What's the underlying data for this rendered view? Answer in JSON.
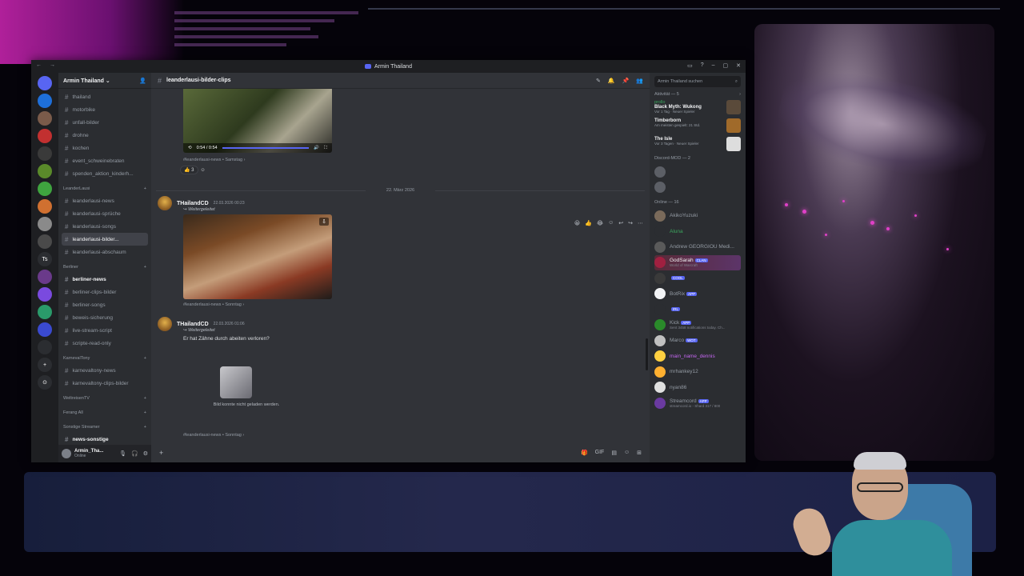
{
  "window": {
    "title": "Armin Thailand",
    "nav_back": "←",
    "nav_forward": "→",
    "controls": [
      "▭",
      "?",
      "–",
      "▢",
      "✕"
    ]
  },
  "servers": [
    "",
    "",
    "",
    "",
    "",
    "",
    "",
    "",
    "",
    "",
    "Ts",
    "",
    "",
    "",
    "",
    "",
    "+",
    "⊙"
  ],
  "guild": {
    "name": "Armin Thailand",
    "chevron": "⌄",
    "add_icon": "👤"
  },
  "channels": [
    {
      "type": "channel",
      "name": "thailand",
      "state": ""
    },
    {
      "type": "channel",
      "name": "motorbike",
      "state": ""
    },
    {
      "type": "channel",
      "name": "unfall-bilder",
      "state": ""
    },
    {
      "type": "channel",
      "name": "drohne",
      "state": ""
    },
    {
      "type": "channel",
      "name": "kochen",
      "state": ""
    },
    {
      "type": "channel",
      "name": "event_schweinebraten",
      "state": ""
    },
    {
      "type": "channel",
      "name": "spenden_aktion_kinderh...",
      "state": ""
    },
    {
      "type": "category",
      "name": "LeanderLausi",
      "plus": "+"
    },
    {
      "type": "channel",
      "name": "leanderlausi-news",
      "state": ""
    },
    {
      "type": "channel",
      "name": "leanderlausi-sprüche",
      "state": ""
    },
    {
      "type": "channel",
      "name": "leanderlausi-songs",
      "state": ""
    },
    {
      "type": "channel",
      "name": "leanderlausi-bilder...",
      "state": "active"
    },
    {
      "type": "channel",
      "name": "leanderlausi-abschaum",
      "state": ""
    },
    {
      "type": "category",
      "name": "Berliner",
      "plus": "+"
    },
    {
      "type": "channel",
      "name": "berliner-news",
      "state": "unread"
    },
    {
      "type": "channel",
      "name": "berliner-clips-bilder",
      "state": ""
    },
    {
      "type": "channel",
      "name": "berliner-songs",
      "state": ""
    },
    {
      "type": "channel",
      "name": "beweis-sicherung",
      "state": ""
    },
    {
      "type": "channel",
      "name": "live-stream-script",
      "state": ""
    },
    {
      "type": "channel",
      "name": "scripte-read-only",
      "state": ""
    },
    {
      "type": "category",
      "name": "KarnevalTony",
      "plus": "+"
    },
    {
      "type": "channel",
      "name": "karnevaltony-news",
      "state": ""
    },
    {
      "type": "channel",
      "name": "karnevaltony-clips-bilder",
      "state": ""
    },
    {
      "type": "category",
      "name": "WeltreisenTV",
      "plus": "+"
    },
    {
      "type": "category",
      "name": "Ferang All",
      "plus": "+"
    },
    {
      "type": "category",
      "name": "Sonstige Streamer",
      "plus": "+"
    },
    {
      "type": "channel",
      "name": "news-sonstige",
      "state": "unread"
    }
  ],
  "user_panel": {
    "name": "Armin_Tha...",
    "status": "Online",
    "mic": "🎙",
    "headset": "🎧",
    "settings": "⚙"
  },
  "channel_header": {
    "name": "leanderlausi-bilder-clips",
    "tools": [
      "✎",
      "🔔",
      "📌",
      "👥"
    ]
  },
  "messages": {
    "video1": {
      "time": "0:54 / 0:54",
      "progress": 1.0
    },
    "forward1_meta": "#leanderlausi-news • Samstag ›",
    "reaction": {
      "emoji": "👍",
      "count": "3"
    },
    "date_separator": "22. März 2026",
    "hover_actions": [
      "😀",
      "👍",
      "😂",
      "☺",
      "↩",
      "↪",
      "⋯"
    ],
    "msg2": {
      "author": "THailandCD",
      "timestamp": "22.03.2026 00:23",
      "forwarded": "Weitergeleitet",
      "meta": "#leanderlausi-news • Sonntag ›"
    },
    "msg3": {
      "author": "THailandCD",
      "timestamp": "22.03.2026 01:06",
      "forwarded": "Weitergeleitet",
      "text": "Er hat Zähne durch abeiten verloren?",
      "broken_image_text": "Bild konnte nicht geladen werden.",
      "meta": "#leanderlausi-news • Sonntag ›"
    }
  },
  "composer": {
    "add": "+",
    "tools": [
      "🎁",
      "GIF",
      "▤",
      "☺",
      "⊞"
    ]
  },
  "member_list": {
    "search_placeholder": "Armin Thailand suchen",
    "activity_header": "Aktivität — 5",
    "activities": [
      {
        "who": "prollo",
        "game": "Black Myth: Wukong",
        "detail": "Vor 1 Tag  ·  Neuer Spieler",
        "red": false
      },
      {
        "who": "",
        "game": "Timberborn",
        "detail": "Am meisten gespielt: 21 Std.",
        "red": true
      },
      {
        "who": "",
        "game": "The Isle",
        "detail": "Vor 3 Tagen  ·  Neuer Spieler",
        "red": true
      }
    ],
    "mod_header": "Discord-MOD — 2",
    "mods": [
      {
        "name": "",
        "color": "#ed4245"
      },
      {
        "name": "",
        "color": "#ed4245"
      }
    ],
    "online_header": "Online — 16",
    "members": [
      {
        "name": "AkikoYuzuki",
        "color": "#949ba4",
        "tag": "",
        "sub": ""
      },
      {
        "name": "Aluna",
        "color": "#3ba55d",
        "tag": "",
        "sub": ""
      },
      {
        "name": "Andrew GEORGIOU Medi...",
        "color": "#949ba4",
        "tag": "",
        "sub": ""
      },
      {
        "name": "GodSarah",
        "color": "#f2f3f5",
        "tag": "CLAN",
        "sub": "World of Warcraft"
      },
      {
        "name": "",
        "color": "#c466f0",
        "tag": "COOL",
        "sub": ""
      },
      {
        "name": "BotRix",
        "color": "#949ba4",
        "tag": "APP",
        "sub": ""
      },
      {
        "name": "",
        "color": "#c466f0",
        "tag": "IRL",
        "sub": ""
      },
      {
        "name": "Kick",
        "color": "#949ba4",
        "tag": "APP",
        "sub": "Sent 3458 notifications today. Ch..."
      },
      {
        "name": "Marco",
        "color": "#949ba4",
        "tag": "WOT",
        "sub": ""
      },
      {
        "name": "main_name_dennis",
        "color": "#c466f0",
        "tag": "",
        "sub": ""
      },
      {
        "name": "mrhankey12",
        "color": "#949ba4",
        "tag": "",
        "sub": ""
      },
      {
        "name": "nyan86",
        "color": "#949ba4",
        "tag": "",
        "sub": ""
      },
      {
        "name": "Streamcord",
        "color": "#949ba4",
        "tag": "APP",
        "sub": "streamcord.io - Shard 317 / 800"
      }
    ]
  }
}
